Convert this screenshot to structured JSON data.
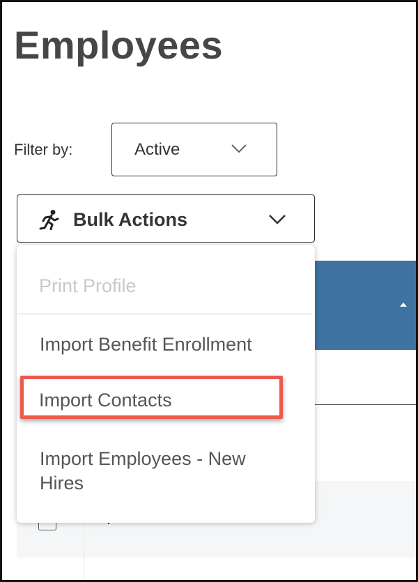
{
  "page": {
    "title": "Employees"
  },
  "filter": {
    "label": "Filter by:",
    "selected": "Active"
  },
  "bulk_actions": {
    "label": "Bulk Actions"
  },
  "menu": {
    "items": [
      {
        "label": "Print Profile",
        "disabled": true
      },
      {
        "label": "Import Benefit Enrollment",
        "disabled": false
      },
      {
        "label": "Import Contacts",
        "disabled": false,
        "highlighted": true
      },
      {
        "label": "Import Employees - New Hires",
        "disabled": false
      }
    ]
  },
  "colors": {
    "table_header": "#3e73a1",
    "highlight_border": "#ec5a4c",
    "disabled_text": "#c9c9c9",
    "title_text": "#464646"
  }
}
